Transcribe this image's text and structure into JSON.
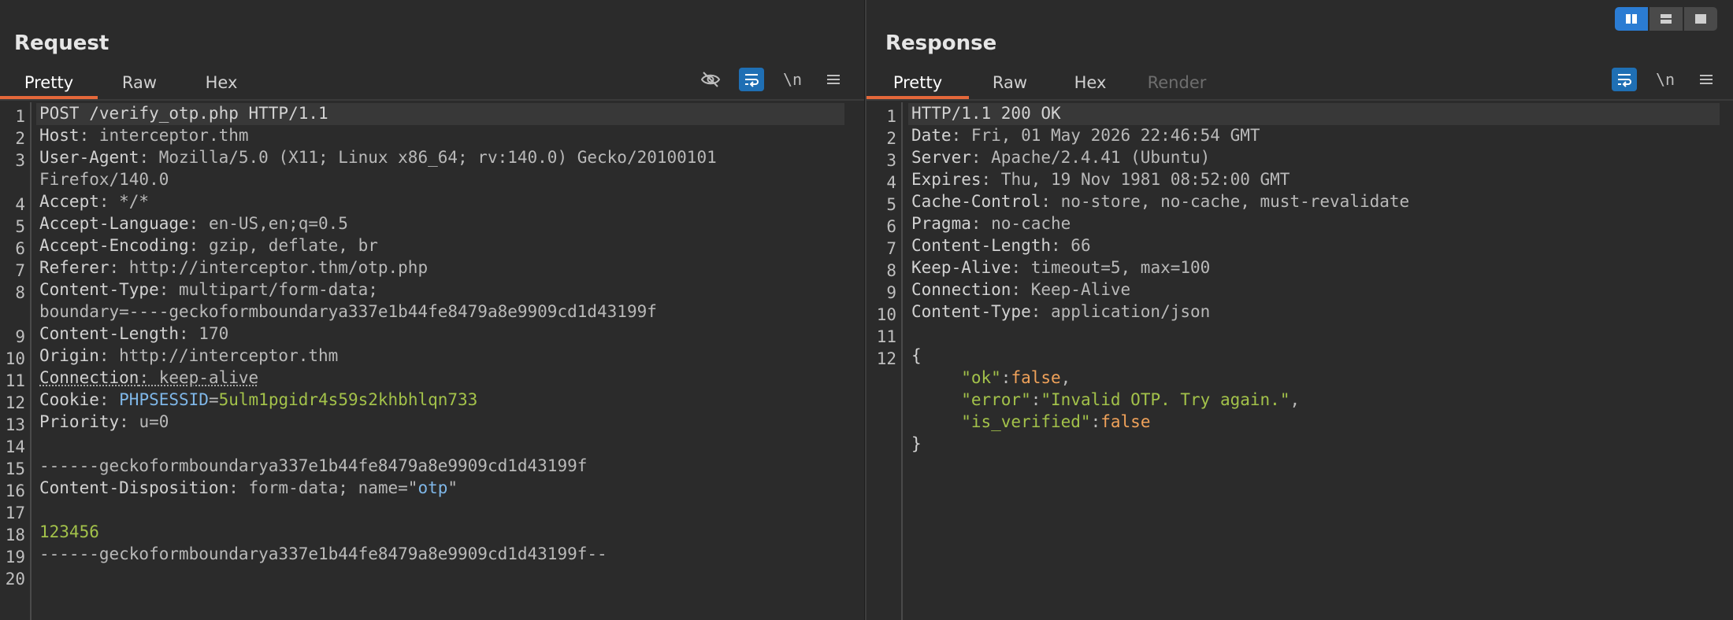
{
  "request": {
    "title": "Request",
    "tabs": [
      "Pretty",
      "Raw",
      "Hex"
    ],
    "active_tab": "Pretty",
    "tools": {
      "hide_icon": "eye-slash-icon",
      "wrap_icon": "word-wrap-icon",
      "newline_label": "\\n",
      "menu_icon": "hamburger-icon"
    },
    "lines": [
      {
        "n": "1",
        "parts": [
          [
            "k",
            "POST /verify_otp.php HTTP/1.1"
          ]
        ]
      },
      {
        "n": "2",
        "parts": [
          [
            "k",
            "Host"
          ],
          [
            "v",
            ": interceptor.thm"
          ]
        ]
      },
      {
        "n": "3",
        "parts": [
          [
            "k",
            "User-Agent"
          ],
          [
            "v",
            ": Mozilla/5.0 (X11; Linux x86_64; rv:140.0) Gecko/20100101"
          ]
        ]
      },
      {
        "n": "",
        "parts": [
          [
            "v",
            "Firefox/140.0"
          ]
        ]
      },
      {
        "n": "4",
        "parts": [
          [
            "k",
            "Accept"
          ],
          [
            "v",
            ": */*"
          ]
        ]
      },
      {
        "n": "5",
        "parts": [
          [
            "k",
            "Accept-Language"
          ],
          [
            "v",
            ": en-US,en;q=0.5"
          ]
        ]
      },
      {
        "n": "6",
        "parts": [
          [
            "k",
            "Accept-Encoding"
          ],
          [
            "v",
            ": gzip, deflate, br"
          ]
        ]
      },
      {
        "n": "7",
        "parts": [
          [
            "k",
            "Referer"
          ],
          [
            "v",
            ": http://interceptor.thm/otp.php"
          ]
        ]
      },
      {
        "n": "8",
        "parts": [
          [
            "k",
            "Content-Type"
          ],
          [
            "v",
            ": multipart/form-data;"
          ]
        ]
      },
      {
        "n": "",
        "parts": [
          [
            "v",
            "boundary=----geckoformboundarya337e1b44fe8479a8e9909cd1d43199f"
          ]
        ]
      },
      {
        "n": "9",
        "parts": [
          [
            "k",
            "Content-Length"
          ],
          [
            "v",
            ": 170"
          ]
        ]
      },
      {
        "n": "10",
        "parts": [
          [
            "k",
            "Origin"
          ],
          [
            "v",
            ": http://interceptor.thm"
          ]
        ]
      },
      {
        "n": "11",
        "parts": [
          [
            "ku",
            "Connection"
          ],
          [
            "vu",
            ": keep-alive"
          ]
        ]
      },
      {
        "n": "12",
        "parts": [
          [
            "k",
            "Cookie"
          ],
          [
            "v",
            ": "
          ],
          [
            "b",
            "PHPSESSID"
          ],
          [
            "v",
            "="
          ],
          [
            "g",
            "5ulm1pgidr4s59s2khbhlqn733"
          ]
        ]
      },
      {
        "n": "13",
        "parts": [
          [
            "k",
            "Priority"
          ],
          [
            "v",
            ": u=0"
          ]
        ]
      },
      {
        "n": "14",
        "parts": []
      },
      {
        "n": "15",
        "parts": [
          [
            "v",
            "------geckoformboundarya337e1b44fe8479a8e9909cd1d43199f"
          ]
        ]
      },
      {
        "n": "16",
        "parts": [
          [
            "k",
            "Content-Disposition"
          ],
          [
            "v",
            ": form-data; name=\""
          ],
          [
            "b",
            "otp"
          ],
          [
            "v",
            "\""
          ]
        ]
      },
      {
        "n": "17",
        "parts": []
      },
      {
        "n": "18",
        "parts": [
          [
            "g",
            "123456"
          ]
        ]
      },
      {
        "n": "19",
        "parts": [
          [
            "v",
            "------geckoformboundarya337e1b44fe8479a8e9909cd1d43199f--"
          ]
        ]
      },
      {
        "n": "20",
        "parts": []
      }
    ]
  },
  "response": {
    "title": "Response",
    "tabs": [
      "Pretty",
      "Raw",
      "Hex",
      "Render"
    ],
    "active_tab": "Pretty",
    "disabled_tab": "Render",
    "tools": {
      "wrap_icon": "word-wrap-icon",
      "newline_label": "\\n",
      "menu_icon": "hamburger-icon"
    },
    "lines": [
      {
        "n": "1",
        "parts": [
          [
            "k",
            "HTTP/1.1 200 OK"
          ]
        ]
      },
      {
        "n": "2",
        "parts": [
          [
            "k",
            "Date"
          ],
          [
            "v",
            ": Fri, 01 May 2026 22:46:54 GMT"
          ]
        ]
      },
      {
        "n": "3",
        "parts": [
          [
            "k",
            "Server"
          ],
          [
            "v",
            ": Apache/2.4.41 (Ubuntu)"
          ]
        ]
      },
      {
        "n": "4",
        "parts": [
          [
            "k",
            "Expires"
          ],
          [
            "v",
            ": Thu, 19 Nov 1981 08:52:00 GMT"
          ]
        ]
      },
      {
        "n": "5",
        "parts": [
          [
            "k",
            "Cache-Control"
          ],
          [
            "v",
            ": no-store, no-cache, must-revalidate"
          ]
        ]
      },
      {
        "n": "6",
        "parts": [
          [
            "k",
            "Pragma"
          ],
          [
            "v",
            ": no-cache"
          ]
        ]
      },
      {
        "n": "7",
        "parts": [
          [
            "k",
            "Content-Length"
          ],
          [
            "v",
            ": 66"
          ]
        ]
      },
      {
        "n": "8",
        "parts": [
          [
            "k",
            "Keep-Alive"
          ],
          [
            "v",
            ": timeout=5, max=100"
          ]
        ]
      },
      {
        "n": "9",
        "parts": [
          [
            "k",
            "Connection"
          ],
          [
            "v",
            ": Keep-Alive"
          ]
        ]
      },
      {
        "n": "10",
        "parts": [
          [
            "k",
            "Content-Type"
          ],
          [
            "v",
            ": application/json"
          ]
        ]
      },
      {
        "n": "11",
        "parts": []
      },
      {
        "n": "12",
        "parts": [
          [
            "k",
            "{"
          ]
        ]
      },
      {
        "n": "",
        "parts": [
          [
            "k",
            "     "
          ],
          [
            "g",
            "\"ok\""
          ],
          [
            "v",
            ":"
          ],
          [
            "o",
            "false"
          ],
          [
            "v",
            ","
          ]
        ]
      },
      {
        "n": "",
        "parts": [
          [
            "k",
            "     "
          ],
          [
            "g",
            "\"error\""
          ],
          [
            "v",
            ":"
          ],
          [
            "g",
            "\"Invalid OTP. Try again.\""
          ],
          [
            "v",
            ","
          ]
        ]
      },
      {
        "n": "",
        "parts": [
          [
            "k",
            "     "
          ],
          [
            "g",
            "\"is_verified\""
          ],
          [
            "v",
            ":"
          ],
          [
            "o",
            "false"
          ]
        ]
      },
      {
        "n": "",
        "parts": [
          [
            "k",
            "}"
          ]
        ]
      }
    ]
  },
  "layout_toggle": [
    "split-horizontal-icon",
    "split-vertical-icon",
    "single-pane-icon"
  ],
  "colors": {
    "accent": "#e4683a",
    "selected": "#1f6fb4",
    "green": "#a3c24a",
    "blue": "#7fb7e8",
    "orange": "#f0a25a"
  }
}
